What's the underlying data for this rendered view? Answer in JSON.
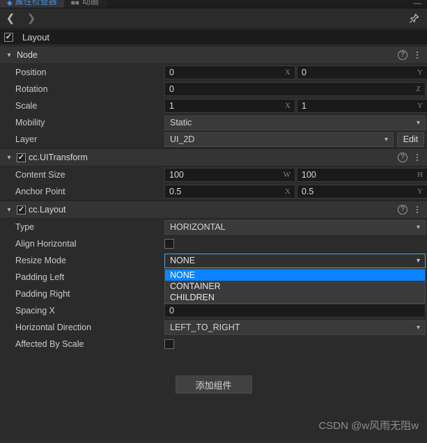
{
  "window": {
    "tabs": [
      {
        "label": "属性检查器",
        "icon": "shield-icon",
        "active": true
      },
      {
        "label": "动画",
        "icon": "film-icon",
        "active": false
      }
    ],
    "minimize_label": "—"
  },
  "navbar": {
    "back_icon": "chevron-left-icon",
    "forward_icon": "chevron-right-icon",
    "pin_icon": "pin-icon"
  },
  "node_name": {
    "label": "Layout",
    "enabled": true
  },
  "sections": [
    {
      "id": "node",
      "title": "Node",
      "has_checkbox": false,
      "caret": "⌄",
      "help_icon": "help-circle-icon",
      "menu_icon": "more-vertical-icon",
      "rows": [
        {
          "label": "Position",
          "kind": "vec2",
          "x": "0",
          "y": "0",
          "axis_x": "X",
          "axis_y": "Y"
        },
        {
          "label": "Rotation",
          "kind": "num1",
          "value": "0",
          "axis": "Z"
        },
        {
          "label": "Scale",
          "kind": "vec2",
          "x": "1",
          "y": "1",
          "axis_x": "X",
          "axis_y": "Y"
        },
        {
          "label": "Mobility",
          "kind": "select",
          "value": "Static"
        },
        {
          "label": "Layer",
          "kind": "select_edit",
          "value": "UI_2D",
          "button": "Edit"
        }
      ]
    },
    {
      "id": "uitransform",
      "title": "cc.UITransform",
      "has_checkbox": true,
      "checked": true,
      "caret": "⌄",
      "help_icon": "help-circle-icon",
      "menu_icon": "more-vertical-icon",
      "rows": [
        {
          "label": "Content Size",
          "kind": "vec2",
          "x": "100",
          "y": "100",
          "axis_x": "W",
          "axis_y": "H"
        },
        {
          "label": "Anchor Point",
          "kind": "vec2",
          "x": "0.5",
          "y": "0.5",
          "axis_x": "X",
          "axis_y": "Y"
        }
      ]
    },
    {
      "id": "layout",
      "title": "cc.Layout",
      "has_checkbox": true,
      "checked": true,
      "caret": "⌄",
      "help_icon": "help-circle-icon",
      "menu_icon": "more-vertical-icon",
      "rows": [
        {
          "label": "Type",
          "kind": "select",
          "value": "HORIZONTAL"
        },
        {
          "label": "Align Horizontal",
          "kind": "checkbox",
          "checked": false
        },
        {
          "label": "Resize Mode",
          "kind": "dropdown_open",
          "value": "NONE",
          "options": [
            "NONE",
            "CONTAINER",
            "CHILDREN"
          ],
          "selected_index": 0
        },
        {
          "label": "Padding Left",
          "kind": "hidden_num",
          "value": ""
        },
        {
          "label": "Padding Right",
          "kind": "hidden_num",
          "value": ""
        },
        {
          "label": "Spacing X",
          "kind": "num1",
          "value": "0",
          "axis": ""
        },
        {
          "label": "Horizontal Direction",
          "kind": "select",
          "value": "LEFT_TO_RIGHT"
        },
        {
          "label": "Affected By Scale",
          "kind": "checkbox",
          "checked": false
        }
      ]
    }
  ],
  "add_component": {
    "label": "添加组件"
  },
  "watermark": {
    "text": "CSDN @w风雨无阻w"
  }
}
